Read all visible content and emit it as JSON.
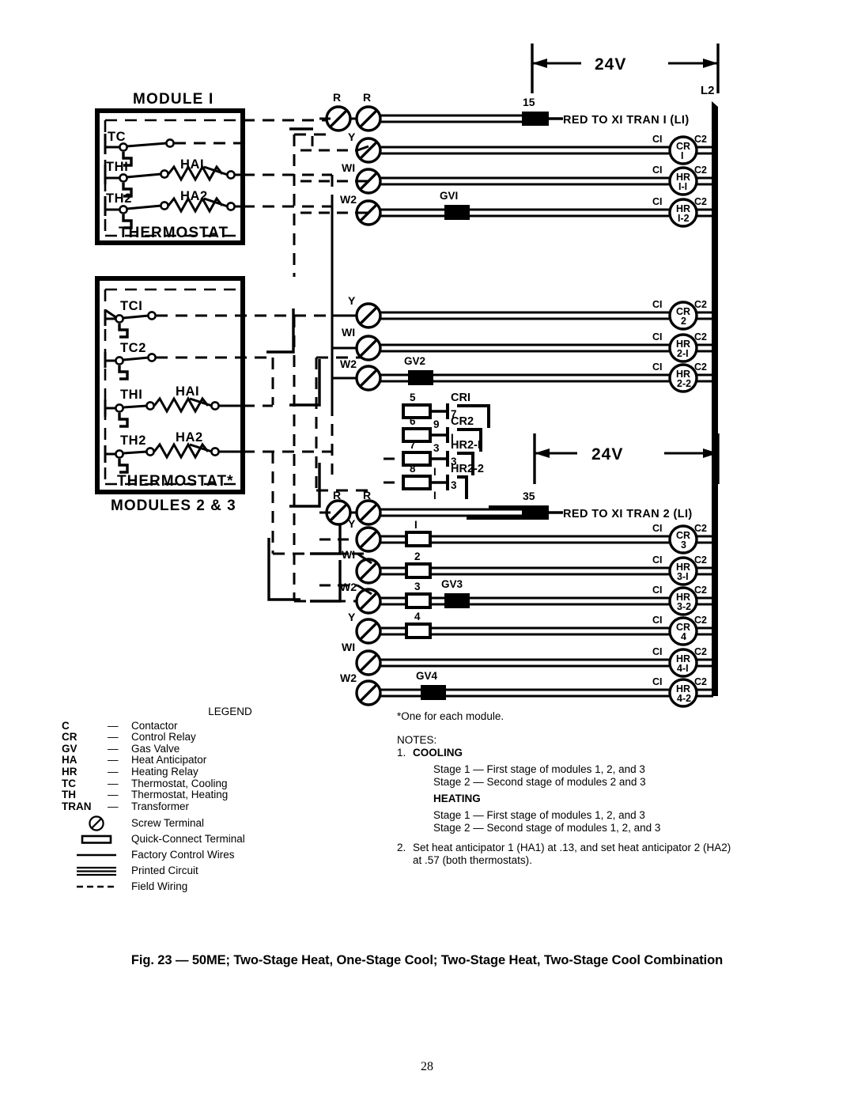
{
  "document": {
    "page_number": "28",
    "caption": "Fig. 23 — 50ME; Two-Stage Heat, One-Stage Cool; Two-Stage Heat, Two-Stage Cool Combination"
  },
  "diagram": {
    "modules": {
      "module1": {
        "title": "MODULE I",
        "box_label": "THERMOSTAT",
        "switches": [
          {
            "name": "TC"
          },
          {
            "name": "THI",
            "anticipator": "HAI"
          },
          {
            "name": "TH2",
            "anticipator": "HA2"
          }
        ]
      },
      "modules23": {
        "box_label": "THERMOSTAT*",
        "caption": "MODULES 2 & 3",
        "switches": [
          {
            "name": "TCI"
          },
          {
            "name": "TC2"
          },
          {
            "name": "THI",
            "anticipator": "HAI"
          },
          {
            "name": "TH2",
            "anticipator": "HA2"
          }
        ]
      }
    },
    "voltage_labels": [
      "24V",
      "24V"
    ],
    "bus_label": "L2",
    "transformer_leads": [
      {
        "terminal": "15",
        "text": "RED TO XI TRAN I (LI)"
      },
      {
        "terminal": "35",
        "text": "RED TO XI TRAN 2 (LI)"
      }
    ],
    "circuit_rows": [
      {
        "terminals": [
          "R",
          "R"
        ],
        "quick_connect": "15",
        "lead": "RED TO XI TRAN I (LI)",
        "coil": null
      },
      {
        "terminals": [
          "Y"
        ],
        "quick_connect": null,
        "gas_valve": null,
        "coil": {
          "name": "CR",
          "sub": "I",
          "left": "CI",
          "right": "C2"
        }
      },
      {
        "terminals": [
          "WI"
        ],
        "quick_connect": null,
        "gas_valve": null,
        "coil": {
          "name": "HR",
          "sub": "I-I",
          "left": "CI",
          "right": "C2"
        }
      },
      {
        "terminals": [
          "W2"
        ],
        "quick_connect": null,
        "gas_valve": "GVI",
        "coil": {
          "name": "HR",
          "sub": "I-2",
          "left": "CI",
          "right": "C2"
        }
      },
      {
        "terminals": [
          "Y"
        ],
        "quick_connect": null,
        "gas_valve": null,
        "coil": {
          "name": "CR",
          "sub": "2",
          "left": "CI",
          "right": "C2"
        }
      },
      {
        "terminals": [
          "WI"
        ],
        "quick_connect": null,
        "gas_valve": null,
        "coil": {
          "name": "HR",
          "sub": "2-I",
          "left": "CI",
          "right": "C2"
        }
      },
      {
        "terminals": [
          "W2"
        ],
        "quick_connect": null,
        "gas_valve": "GV2",
        "coil": {
          "name": "HR",
          "sub": "2-2",
          "left": "CI",
          "right": "C2"
        }
      },
      {
        "terminals": [
          "R",
          "R"
        ],
        "quick_connect": "35",
        "lead": "RED TO XI TRAN 2 (LI)",
        "coil": null
      },
      {
        "terminals": [
          "Y"
        ],
        "quick_connect": "I",
        "gas_valve": null,
        "coil": {
          "name": "CR",
          "sub": "3",
          "left": "CI",
          "right": "C2"
        }
      },
      {
        "terminals": [
          "WI"
        ],
        "quick_connect": "2",
        "gas_valve": null,
        "coil": {
          "name": "HR",
          "sub": "3-I",
          "left": "CI",
          "right": "C2"
        }
      },
      {
        "terminals": [
          "W2"
        ],
        "quick_connect": "3",
        "gas_valve": "GV3",
        "coil": {
          "name": "HR",
          "sub": "3-2",
          "left": "CI",
          "right": "C2"
        }
      },
      {
        "terminals": [
          "Y"
        ],
        "quick_connect": "4",
        "gas_valve": null,
        "coil": {
          "name": "CR",
          "sub": "4",
          "left": "CI",
          "right": "C2"
        }
      },
      {
        "terminals": [
          "WI"
        ],
        "quick_connect": null,
        "gas_valve": null,
        "coil": {
          "name": "HR",
          "sub": "4-I",
          "left": "CI",
          "right": "C2"
        }
      },
      {
        "terminals": [
          "W2"
        ],
        "quick_connect": null,
        "gas_valve": "GV4",
        "coil": {
          "name": "HR",
          "sub": "4-2",
          "left": "CI",
          "right": "C2"
        }
      }
    ],
    "contact_block": [
      {
        "top_num": "5",
        "bottom_num": "9",
        "contact": "CRI",
        "contact_num": "7"
      },
      {
        "top_num": "6",
        "bottom_num": "3",
        "contact": "CR2",
        "contact_num": "I"
      },
      {
        "top_num": "7",
        "bottom_num": "I",
        "contact": "HR2-I",
        "contact_num": "3"
      },
      {
        "top_num": "8",
        "bottom_num": "I",
        "contact": "HR2-2",
        "contact_num": "3"
      }
    ]
  },
  "legend": {
    "title": "LEGEND",
    "abbreviations": [
      {
        "abbr": "C",
        "dash": "—",
        "term": "Contactor"
      },
      {
        "abbr": "CR",
        "dash": "—",
        "term": "Control Relay"
      },
      {
        "abbr": "GV",
        "dash": "—",
        "term": "Gas Valve"
      },
      {
        "abbr": "HA",
        "dash": "—",
        "term": "Heat Anticipator"
      },
      {
        "abbr": "HR",
        "dash": "—",
        "term": "Heating Relay"
      },
      {
        "abbr": "TC",
        "dash": "—",
        "term": "Thermostat, Cooling"
      },
      {
        "abbr": "TH",
        "dash": "—",
        "term": "Thermostat, Heating"
      },
      {
        "abbr": "TRAN",
        "dash": "—",
        "term": "Transformer"
      }
    ],
    "symbols": [
      {
        "icon": "screw-terminal-icon",
        "term": "Screw Terminal"
      },
      {
        "icon": "quick-connect-terminal-icon",
        "term": "Quick-Connect Terminal"
      },
      {
        "icon": "factory-control-wires-icon",
        "term": "Factory Control Wires"
      },
      {
        "icon": "printed-circuit-icon",
        "term": "Printed Circuit"
      },
      {
        "icon": "field-wiring-icon",
        "term": "Field Wiring"
      }
    ]
  },
  "notes": {
    "footnote": "*One for each module.",
    "heading": "NOTES:",
    "items": [
      {
        "number": "1.",
        "cooling_label": "COOLING",
        "cooling_stages": [
          "Stage 1 — First stage of modules 1, 2, and 3",
          "Stage 2 — Second stage of modules 2 and 3"
        ],
        "heating_label": "HEATING",
        "heating_stages": [
          "Stage 1 — First stage of modules 1, 2, and 3",
          "Stage 2 — Second stage of modules 1, 2, and 3"
        ]
      },
      {
        "number": "2.",
        "text_line1": "Set heat anticipator 1 (HA1) at .13, and set heat anticipator 2 (HA2)",
        "text_line2": "at .57 (both thermostats)."
      }
    ]
  }
}
